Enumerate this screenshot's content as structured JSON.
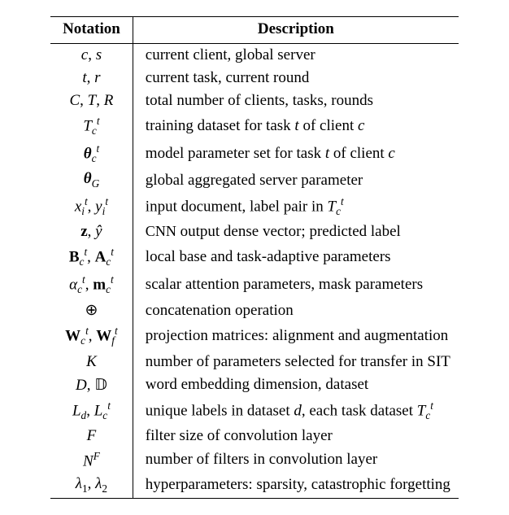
{
  "headers": {
    "notation": "Notation",
    "description": "Description"
  },
  "rows": [
    {
      "notation_html": "<span class='math'>c</span>, <span class='math'>s</span>",
      "description": "current client, global server"
    },
    {
      "notation_html": "<span class='math'>t</span>, <span class='math'>r</span>",
      "description": "current task, current round"
    },
    {
      "notation_html": "<span class='math'>C</span>, <span class='math'>T</span>, <span class='math'>R</span>",
      "description": "total number of clients, tasks, rounds"
    },
    {
      "notation_html": "<span class='cal'>T</span><sub class='math'>c</sub><sup class='math'>t</sup>",
      "description_html": "training dataset for task <span class='math'>t</span> of client <span class='math'>c</span>"
    },
    {
      "notation_html": "<span class='math bold'>θ</span><sub class='math'>c</sub><sup class='math'>t</sup>",
      "description_html": "model parameter set for task <span class='math'>t</span> of client <span class='math'>c</span>"
    },
    {
      "notation_html": "<span class='math bold'>θ</span><sub class='math'>G</sub>",
      "description": "global aggregated server parameter"
    },
    {
      "notation_html": "<span class='math'>x</span><sub class='math'>i</sub><sup class='math'>t</sup>, <span class='math'>y</span><sub class='math'>i</sub><sup class='math'>t</sup>",
      "description_html": "input document, label pair in <span class='cal'>T</span><sub class='math'>c</sub><sup class='math'>t</sup>"
    },
    {
      "notation_html": "<span class='rm bold'>z</span>, <span class='math'>ŷ</span>",
      "description_html": "<span class='sc'>CNN</span> output dense vector; predicted label"
    },
    {
      "notation_html": "<span class='rm bold'>B</span><sub class='math'>c</sub><sup class='math'>t</sup>, <span class='rm bold'>A</span><sub class='math'>c</sub><sup class='math'>t</sup>",
      "description": "local base and task-adaptive parameters"
    },
    {
      "notation_html": "<span class='math'>α</span><sub class='math'>c</sub><sup class='math'>t</sup>, <span class='rm bold'>m</span><sub class='math'>c</sub><sup class='math'>t</sup>",
      "description": "scalar attention parameters, mask parameters"
    },
    {
      "notation_html": "⊕",
      "description": "concatenation operation"
    },
    {
      "notation_html": "<span class='rm bold'>W</span><sub class='math'>c</sub><sup class='math'>t</sup>, <span class='rm bold'>W</span><sub class='math'>f</sub><sup class='math'>t</sup>",
      "description": "projection matrices: alignment and augmentation"
    },
    {
      "notation_html": "<span class='math'>K</span>",
      "description": "number of parameters selected for transfer in SIT"
    },
    {
      "notation_html": "<span class='cal'>D</span>, 𝔻",
      "description": "word embedding dimension, dataset"
    },
    {
      "notation_html": "<span class='math'>L</span><sub class='math'>d</sub>, <span class='math'>L</span><sub class='math'>c</sub><sup class='math'>t</sup>",
      "description_html": "unique labels in dataset <span class='math'>d</span>, each task dataset <span class='cal'>T</span><sub class='math'>c</sub><sup class='math'>t</sup>"
    },
    {
      "notation_html": "<span class='cal'>F</span>",
      "description": "filter size of convolution layer"
    },
    {
      "notation_html": "<span class='cal'>N</span><sup class='cal'>F</sup>",
      "description": "number of filters in convolution layer"
    },
    {
      "notation_html": "<span class='math'>λ</span><sub class='rm'>1</sub>, <span class='math'>λ</span><sub class='rm'>2</sub>",
      "description": "hyperparameters: sparsity, catastrophic forgetting"
    }
  ]
}
